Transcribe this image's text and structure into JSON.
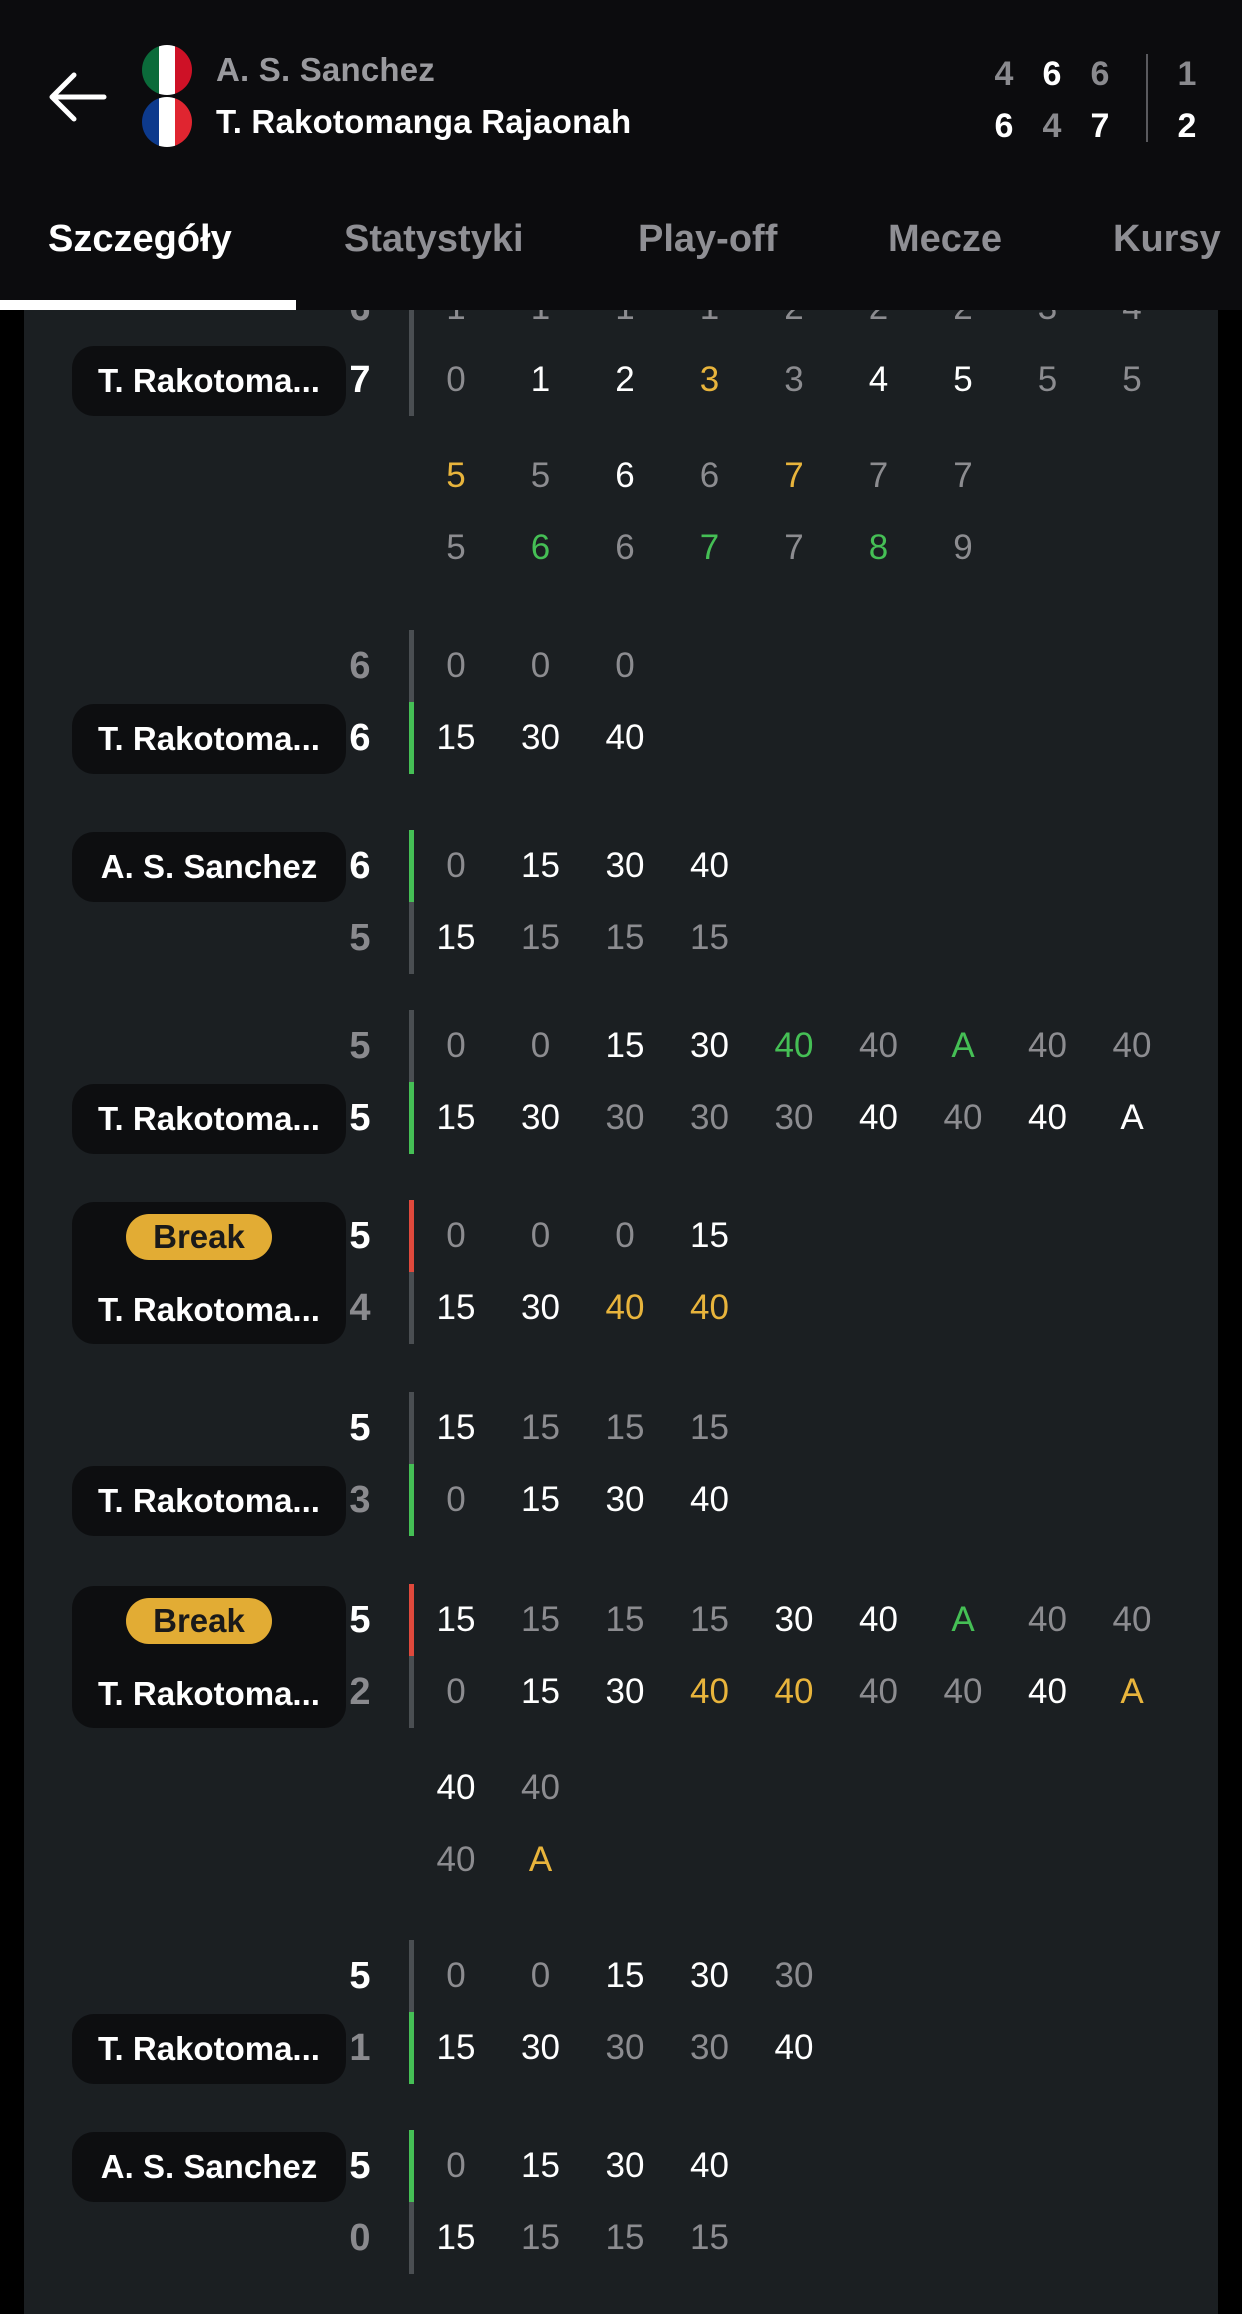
{
  "header": {
    "player1": {
      "name": "A. S. Sanchez",
      "flag": [
        "#0b6b3a",
        "#ffffff",
        "#ce1126"
      ]
    },
    "player2": {
      "name": "T. Rakotomanga Rajaonah",
      "flag": [
        "#0d3a8c",
        "#ffffff",
        "#e02530"
      ]
    },
    "sets_p1": [
      "4",
      "6",
      "6"
    ],
    "sets_p2": [
      "6",
      "4",
      "7"
    ],
    "total_p1": "1",
    "total_p2": "2"
  },
  "tabs": [
    {
      "label": "Szczegóły",
      "active": true
    },
    {
      "label": "Statystyki",
      "active": false
    },
    {
      "label": "Play-off",
      "active": false
    },
    {
      "label": "Mecze",
      "active": false
    },
    {
      "label": "Kursy",
      "active": false
    }
  ],
  "games": [
    {
      "top": {
        "score": "6",
        "points": [
          "1",
          "1",
          "1",
          "1",
          "2",
          "2",
          "2",
          "3",
          "4"
        ]
      },
      "bottom": {
        "score": "7",
        "points": [
          [
            "0",
            "d"
          ],
          [
            "1",
            "w"
          ],
          [
            "2",
            "w"
          ],
          [
            "3",
            "y"
          ],
          [
            "3",
            "d"
          ],
          [
            "4",
            "w"
          ],
          [
            "5",
            "w"
          ],
          [
            "5",
            "d"
          ],
          [
            "5",
            "d"
          ]
        ]
      },
      "pill": "T. Rakotoma...",
      "pillSide": "bottom",
      "extra": [
        [
          [
            "5",
            "y"
          ],
          [
            "5",
            "d"
          ],
          [
            "6",
            "w"
          ],
          [
            "6",
            "d"
          ],
          [
            "7",
            "y"
          ],
          [
            "7",
            "d"
          ],
          [
            "7",
            "d"
          ]
        ],
        [
          [
            "5",
            "d"
          ],
          [
            "6",
            "g"
          ],
          [
            "6",
            "d"
          ],
          [
            "7",
            "g"
          ],
          [
            "7",
            "d"
          ],
          [
            "8",
            "g"
          ],
          [
            "9",
            "d"
          ]
        ]
      ]
    },
    {
      "top": {
        "score": "6",
        "points": [
          [
            "0",
            "d"
          ],
          [
            "0",
            "d"
          ],
          [
            "0",
            "d"
          ]
        ]
      },
      "bottom": {
        "score": "6",
        "points": [
          [
            "15",
            "w"
          ],
          [
            "30",
            "w"
          ],
          [
            "40",
            "w"
          ]
        ]
      },
      "pill": "T. Rakotoma...",
      "pillSide": "bottom",
      "bar": "bottom-green"
    },
    {
      "top": {
        "score": "6",
        "points": [
          [
            "0",
            "d"
          ],
          [
            "15",
            "w"
          ],
          [
            "30",
            "w"
          ],
          [
            "40",
            "w"
          ]
        ]
      },
      "bottom": {
        "score": "5",
        "points": [
          [
            "15",
            "w"
          ],
          [
            "15",
            "d"
          ],
          [
            "15",
            "d"
          ],
          [
            "15",
            "d"
          ]
        ]
      },
      "pill": "A. S. Sanchez",
      "pillSide": "top",
      "bar": "top-green"
    },
    {
      "top": {
        "score": "5",
        "points": [
          [
            "0",
            "d"
          ],
          [
            "0",
            "d"
          ],
          [
            "15",
            "w"
          ],
          [
            "30",
            "w"
          ],
          [
            "40",
            "g"
          ],
          [
            "40",
            "d"
          ],
          [
            "A",
            "g"
          ],
          [
            "40",
            "d"
          ],
          [
            "40",
            "d"
          ]
        ]
      },
      "bottom": {
        "score": "5",
        "points": [
          [
            "15",
            "w"
          ],
          [
            "30",
            "w"
          ],
          [
            "30",
            "d"
          ],
          [
            "30",
            "d"
          ],
          [
            "30",
            "d"
          ],
          [
            "40",
            "w"
          ],
          [
            "40",
            "d"
          ],
          [
            "40",
            "w"
          ],
          [
            "A",
            "w"
          ]
        ]
      },
      "pill": "T. Rakotoma...",
      "pillSide": "bottom",
      "bar": "bottom-green"
    },
    {
      "top": {
        "score": "5",
        "points": [
          [
            "0",
            "d"
          ],
          [
            "0",
            "d"
          ],
          [
            "0",
            "d"
          ],
          [
            "15",
            "w"
          ]
        ]
      },
      "bottom": {
        "score": "4",
        "points": [
          [
            "15",
            "w"
          ],
          [
            "30",
            "w"
          ],
          [
            "40",
            "y"
          ],
          [
            "40",
            "y"
          ]
        ]
      },
      "pill": "T. Rakotoma...",
      "pillSide": "break",
      "bar": "top-red",
      "badge": "Break"
    },
    {
      "top": {
        "score": "5",
        "points": [
          [
            "15",
            "w"
          ],
          [
            "15",
            "d"
          ],
          [
            "15",
            "d"
          ],
          [
            "15",
            "d"
          ]
        ]
      },
      "bottom": {
        "score": "3",
        "points": [
          [
            "0",
            "d"
          ],
          [
            "15",
            "w"
          ],
          [
            "30",
            "w"
          ],
          [
            "40",
            "w"
          ]
        ]
      },
      "pill": "T. Rakotoma...",
      "pillSide": "bottom",
      "bar": "bottom-green"
    },
    {
      "top": {
        "score": "5",
        "points": [
          [
            "15",
            "w"
          ],
          [
            "15",
            "d"
          ],
          [
            "15",
            "d"
          ],
          [
            "15",
            "d"
          ],
          [
            "30",
            "w"
          ],
          [
            "40",
            "w"
          ],
          [
            "A",
            "g"
          ],
          [
            "40",
            "d"
          ],
          [
            "40",
            "d"
          ]
        ]
      },
      "bottom": {
        "score": "2",
        "points": [
          [
            "0",
            "d"
          ],
          [
            "15",
            "w"
          ],
          [
            "30",
            "w"
          ],
          [
            "40",
            "y"
          ],
          [
            "40",
            "y"
          ],
          [
            "40",
            "d"
          ],
          [
            "40",
            "d"
          ],
          [
            "40",
            "w"
          ],
          [
            "A",
            "y"
          ]
        ]
      },
      "pill": "T. Rakotoma...",
      "pillSide": "break",
      "bar": "top-red",
      "badge": "Break",
      "extra": [
        [
          [
            "40",
            "w"
          ],
          [
            "40",
            "d"
          ]
        ],
        [
          [
            "40",
            "d"
          ],
          [
            "A",
            "y"
          ]
        ]
      ]
    },
    {
      "top": {
        "score": "5",
        "points": [
          [
            "0",
            "d"
          ],
          [
            "0",
            "d"
          ],
          [
            "15",
            "w"
          ],
          [
            "30",
            "w"
          ],
          [
            "30",
            "d"
          ]
        ]
      },
      "bottom": {
        "score": "1",
        "points": [
          [
            "15",
            "w"
          ],
          [
            "30",
            "w"
          ],
          [
            "30",
            "d"
          ],
          [
            "30",
            "d"
          ],
          [
            "40",
            "w"
          ]
        ]
      },
      "pill": "T. Rakotoma...",
      "pillSide": "bottom",
      "bar": "bottom-green"
    },
    {
      "top": {
        "score": "5",
        "points": [
          [
            "0",
            "d"
          ],
          [
            "15",
            "w"
          ],
          [
            "30",
            "w"
          ],
          [
            "40",
            "w"
          ]
        ]
      },
      "bottom": {
        "score": "0",
        "points": [
          [
            "15",
            "w"
          ],
          [
            "15",
            "d"
          ],
          [
            "15",
            "d"
          ],
          [
            "15",
            "d"
          ]
        ]
      },
      "pill": "A. S. Sanchez",
      "pillSide": "top",
      "bar": "top-green"
    }
  ],
  "colors": {
    "green": "#45bf55",
    "red": "#e0493c",
    "yellow": "#e8b43c",
    "gray_bar": "#4a4e52"
  }
}
